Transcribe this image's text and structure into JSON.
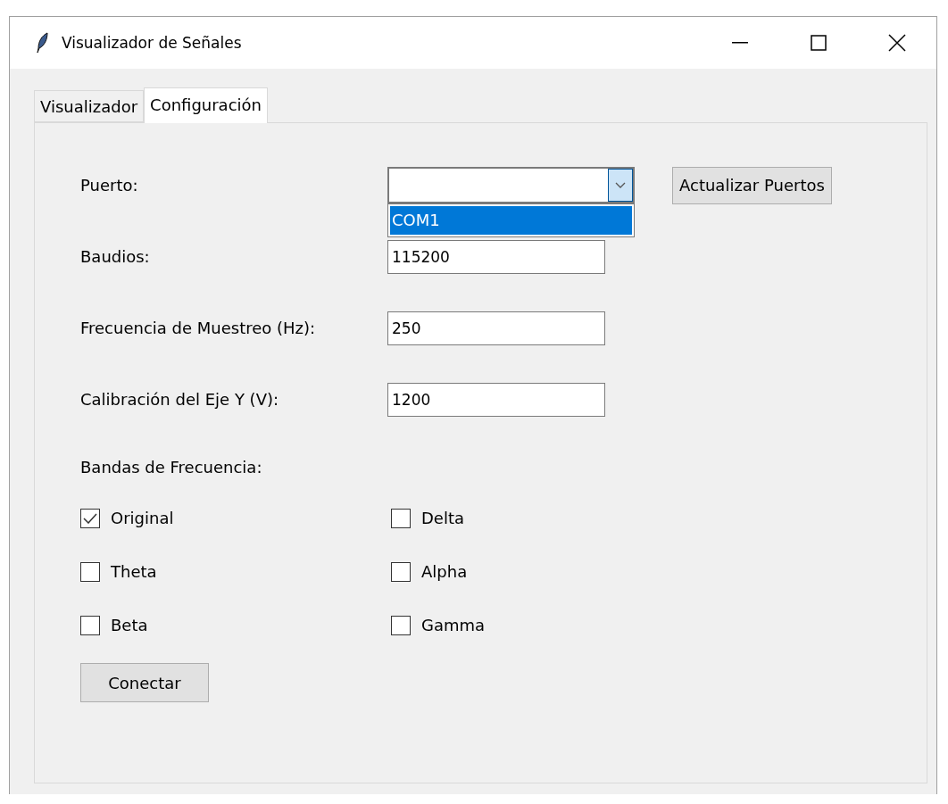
{
  "window": {
    "title": "Visualizador de Señales"
  },
  "tabs": [
    {
      "label": "Visualizador",
      "selected": false
    },
    {
      "label": "Configuración",
      "selected": true
    }
  ],
  "fields": [
    {
      "kind": "combo",
      "label": "Puerto:",
      "expanded": true,
      "options": [
        {
          "label": "COM1",
          "selected": true
        }
      ],
      "button": "Actualizar Puertos"
    },
    {
      "kind": "entry",
      "label": "Baudios:",
      "value": "115200"
    },
    {
      "kind": "entry",
      "label": "Frecuencia de Muestreo (Hz):",
      "value": "250"
    },
    {
      "kind": "entry",
      "label": "Calibración del Eje Y (V):",
      "value": "1200"
    }
  ],
  "bands": {
    "label": "Bandas de Frecuencia:",
    "items": [
      {
        "label": "Original",
        "checked": true
      },
      {
        "label": "Delta",
        "checked": false
      },
      {
        "label": "Theta",
        "checked": false
      },
      {
        "label": "Alpha",
        "checked": false
      },
      {
        "label": "Beta",
        "checked": false
      },
      {
        "label": "Gamma",
        "checked": false
      }
    ]
  },
  "connect_button": "Conectar"
}
